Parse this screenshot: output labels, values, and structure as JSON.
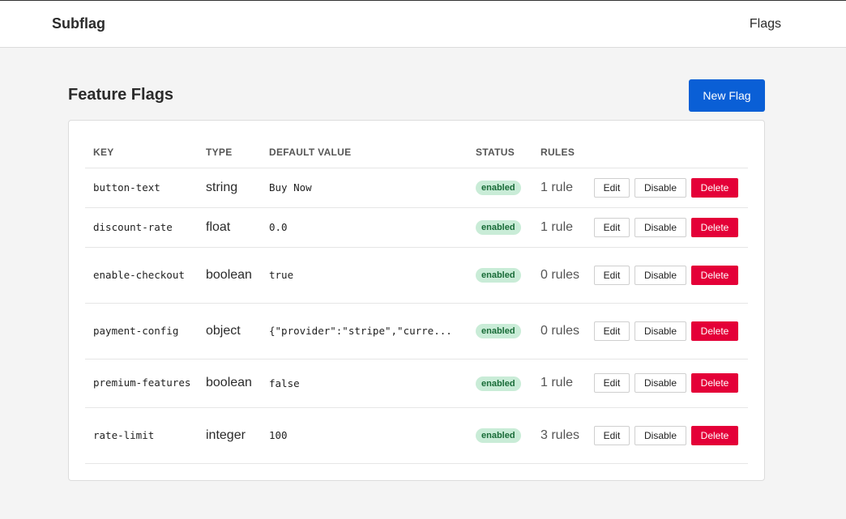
{
  "header": {
    "brand": "Subflag",
    "nav": "Flags"
  },
  "page": {
    "title": "Feature Flags",
    "new_flag_label": "New Flag"
  },
  "table": {
    "columns": {
      "key": "KEY",
      "type": "TYPE",
      "default": "DEFAULT VALUE",
      "status": "STATUS",
      "rules": "RULES"
    },
    "actions": {
      "edit": "Edit",
      "disable": "Disable",
      "delete": "Delete"
    },
    "rows": [
      {
        "key": "button-text",
        "type": "string",
        "default": "Buy Now",
        "status": "enabled",
        "rules": "1 rule"
      },
      {
        "key": "discount-rate",
        "type": "float",
        "default": "0.0",
        "status": "enabled",
        "rules": "1 rule"
      },
      {
        "key": "enable-checkout",
        "type": "boolean",
        "default": "true",
        "status": "enabled",
        "rules": "0 rules"
      },
      {
        "key": "payment-config",
        "type": "object",
        "default": "{\"provider\":\"stripe\",\"curre...",
        "status": "enabled",
        "rules": "0 rules"
      },
      {
        "key": "premium-features",
        "type": "boolean",
        "default": "false",
        "status": "enabled",
        "rules": "1 rule"
      },
      {
        "key": "rate-limit",
        "type": "integer",
        "default": "100",
        "status": "enabled",
        "rules": "3 rules"
      }
    ]
  },
  "colors": {
    "primary": "#0a5fd6",
    "danger": "#e40038",
    "badge_bg": "#c9ecd7",
    "badge_text": "#186b37"
  }
}
